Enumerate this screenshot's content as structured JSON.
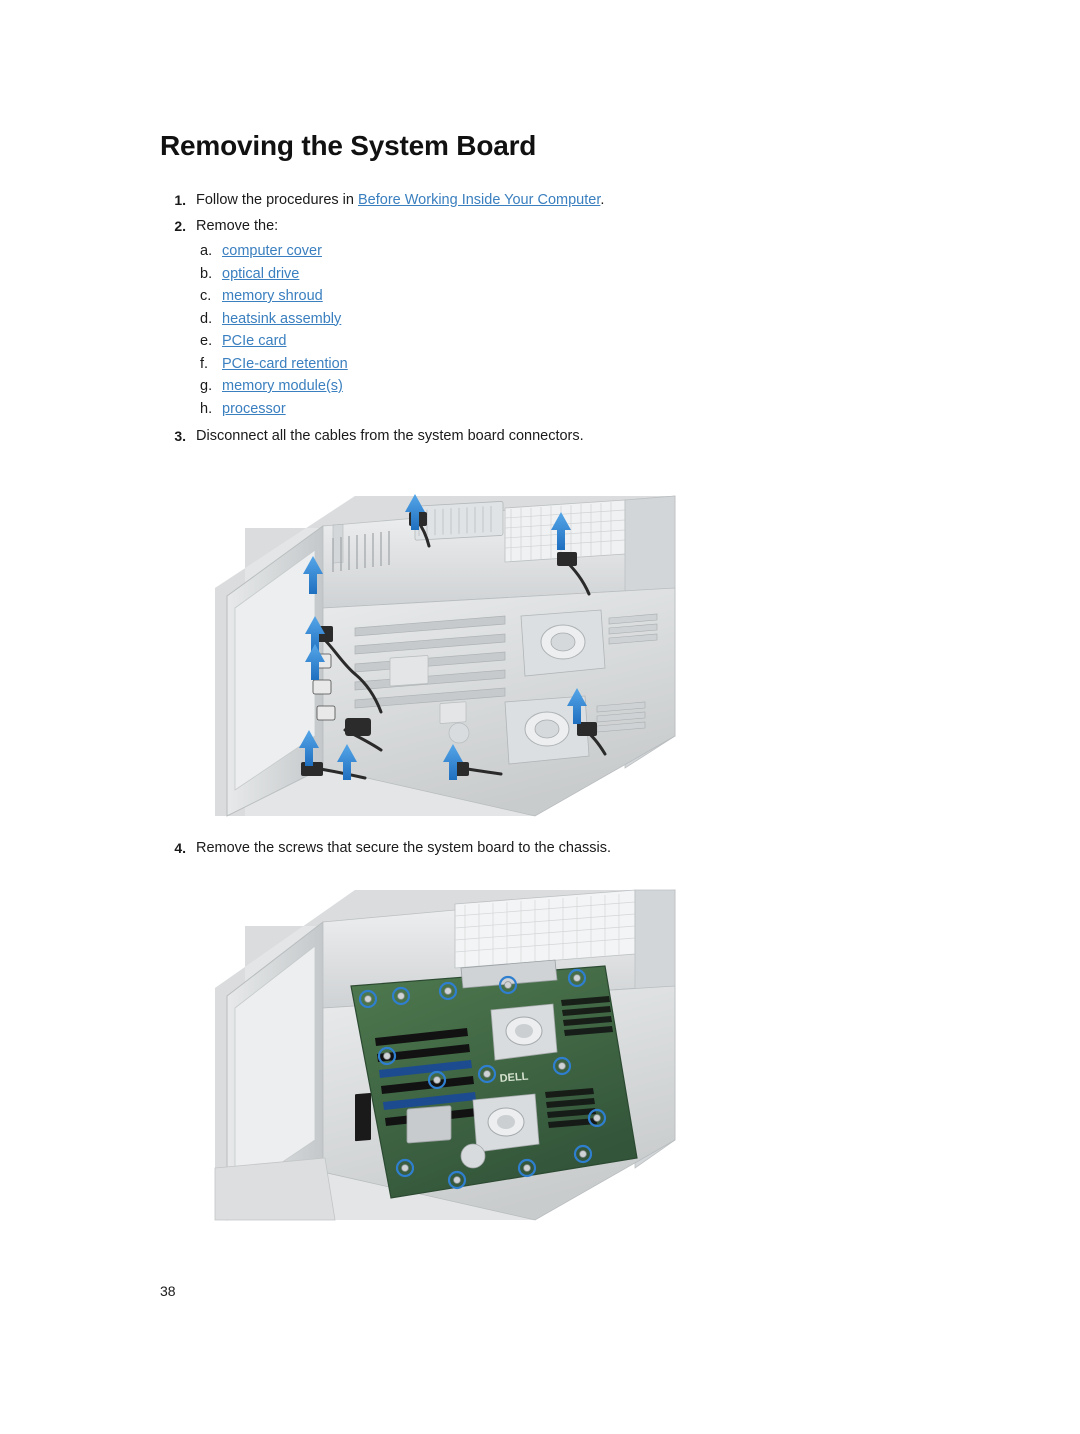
{
  "document": {
    "title": "Removing the System Board",
    "page_number": "38"
  },
  "steps": [
    {
      "num": "1.",
      "text_before": "Follow the procedures in ",
      "link": "Before Working Inside Your Computer",
      "text_after": "."
    },
    {
      "num": "2.",
      "text_before": "Remove the:",
      "link": "",
      "text_after": ""
    },
    {
      "num": "3.",
      "text_before": "Disconnect all the cables from the system board connectors.",
      "link": "",
      "text_after": ""
    },
    {
      "num": "4.",
      "text_before": "Remove the screws that secure the system board to the chassis.",
      "link": "",
      "text_after": ""
    }
  ],
  "sublist": [
    {
      "letter": "a.",
      "label": "computer cover"
    },
    {
      "letter": "b.",
      "label": "optical drive"
    },
    {
      "letter": "c.",
      "label": "memory shroud"
    },
    {
      "letter": "d.",
      "label": "heatsink assembly"
    },
    {
      "letter": "e.",
      "label": "PCIe card"
    },
    {
      "letter": "f.",
      "label": "PCIe-card retention"
    },
    {
      "letter": "g.",
      "label": "memory module(s)"
    },
    {
      "letter": "h.",
      "label": "processor"
    }
  ],
  "figures": [
    {
      "name": "figure-cables-disconnect",
      "caption": "",
      "alt": "Chassis interior with blue arrows indicating cables to disconnect from the system board connectors"
    },
    {
      "name": "figure-system-board-screws",
      "caption": "",
      "alt": "System board installed in chassis with circled screw locations highlighted"
    }
  ],
  "colors": {
    "link": "#3a7fbf",
    "arrow": "#2f7fd0",
    "board_green": "#3c6b3f",
    "chassis_gray": "#d8dadb"
  }
}
